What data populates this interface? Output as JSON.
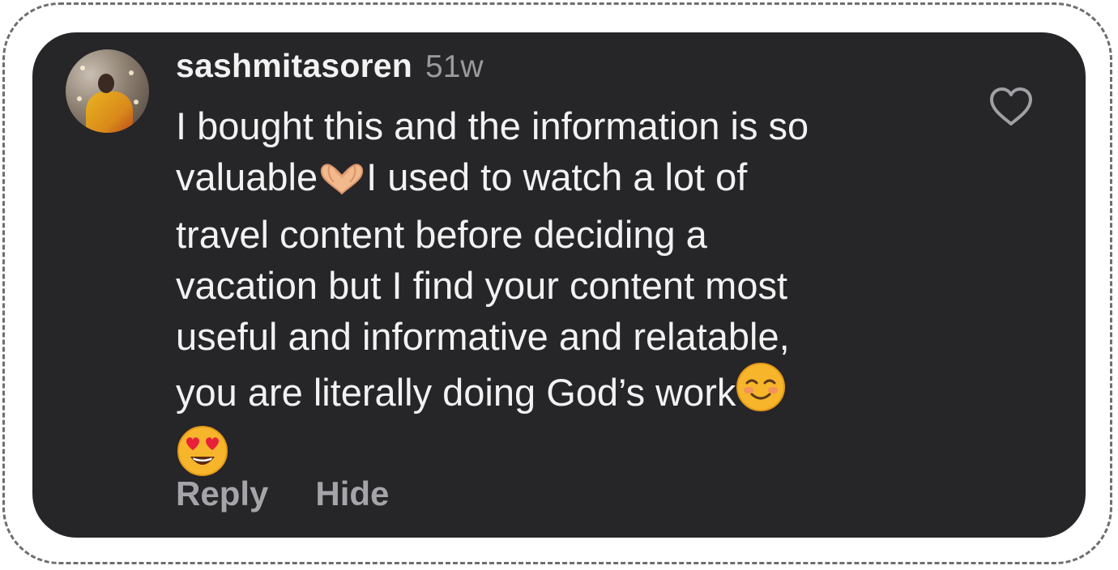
{
  "comment": {
    "username": "sashmitasoren",
    "time": "51w",
    "lines": [
      "I bought this and the information is so",
      "valuable",
      "I used to watch a lot of",
      "travel content before deciding a",
      "vacation but I find your content most",
      "useful and informative and relatable,",
      "you are literally doing God’s work"
    ],
    "emojis": [
      "heart-hands-emoji",
      "smiling-face-emoji",
      "heart-eyes-emoji"
    ]
  },
  "actions": {
    "reply_label": "Reply",
    "hide_label": "Hide"
  },
  "icons": {
    "like": "heart-outline-icon"
  },
  "colors": {
    "card_background": "#262528",
    "text": "#f2f2f2",
    "muted": "#9a9a9e",
    "actions": "#a5a5a9"
  }
}
